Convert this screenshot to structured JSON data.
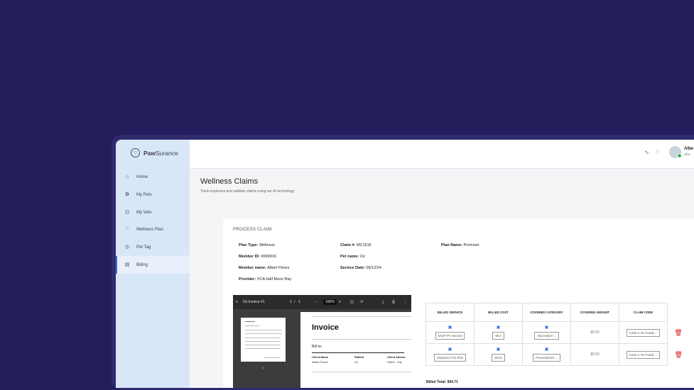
{
  "app": {
    "brand_bold": "Paw",
    "brand_rest": "Surance"
  },
  "sidebar": {
    "items": [
      {
        "label": "Home",
        "icon": "home-icon"
      },
      {
        "label": "My Pets",
        "icon": "paw-icon"
      },
      {
        "label": "My Vets",
        "icon": "clinic-icon"
      },
      {
        "label": "Wellness Plan",
        "icon": "heart-icon"
      },
      {
        "label": "Pet Tag",
        "icon": "tag-icon"
      },
      {
        "label": "Billing",
        "icon": "billing-icon",
        "active": true
      }
    ]
  },
  "user": {
    "name": "Albe",
    "email": "albe"
  },
  "page": {
    "title": "Wellness Claims",
    "subtitle": "Track expenses and validate claims using our AI technology"
  },
  "claim": {
    "section_title": "PROCESS CLAIM",
    "plan_type_label": "Plan Type:",
    "plan_type": "Wellness",
    "member_id_label": "Member ID:",
    "member_id": "4999916",
    "member_name_label": "Member name:",
    "member_name": "Albert Flores",
    "provider_label": "Provider:",
    "provider": "VCA Half Moon Bay",
    "claim_no_label": "Claim #:",
    "claim_no": "MC1516",
    "pet_name_label": "Pet name:",
    "pet_name": "Oz",
    "service_date_label": "Service Date:",
    "service_date": "06/12/24",
    "plan_name_label": "Plan Name:",
    "plan_name": "Premium"
  },
  "viewer": {
    "doc_title": "Oz Invoice #1",
    "page_current": "1",
    "page_sep": "/",
    "page_total": "1",
    "zoom": "100%",
    "minus": "−",
    "plus": "+",
    "thumb_page": "1",
    "invoice_title": "Invoice",
    "bill_to": "Bill to:",
    "col1": "Client Name",
    "col2": "Patient",
    "col3": "Client Adress",
    "val1": "Albert Flores",
    "val2": "Oz",
    "val3": "Street , City"
  },
  "table": {
    "headers": [
      "BILLED SERVICE",
      "BILLED COST",
      "COVERED CATEGORY",
      "COVERED AMOUNT",
      "CLAIM CODE"
    ],
    "rows": [
      {
        "service": "DA2P-Pv Vaccine",
        "cost": "59.2",
        "category": "Vaccination",
        "amount": "$0.00",
        "code": "Code A: No Funds"
      },
      {
        "service": "Simparica Trio Plus",
        "cost": "35.51",
        "category": "Preventatives",
        "amount": "$0.00",
        "code": "Code A: No Funds"
      }
    ]
  },
  "billed_total": {
    "label": "Billed Total:",
    "value": "$94.71"
  }
}
